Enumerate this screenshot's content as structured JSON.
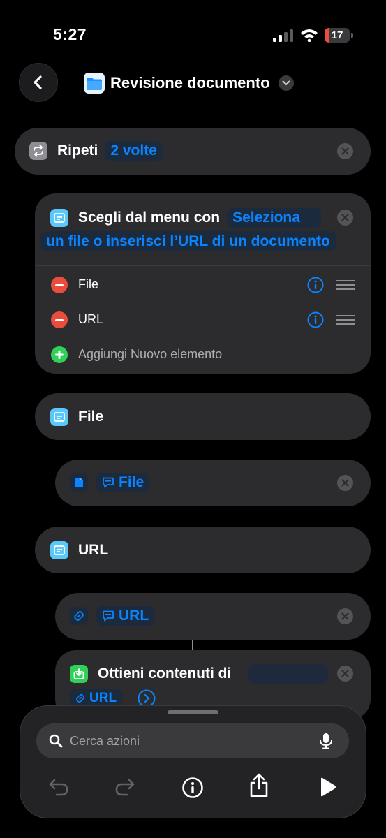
{
  "status_bar": {
    "time": "5:27",
    "battery": "17",
    "battery_level": 0.17
  },
  "nav": {
    "title": "Revisione documento"
  },
  "repeat_block": {
    "label": "Ripeti",
    "count_token": "2 volte"
  },
  "menu_block": {
    "label": "Scegli dal menu con",
    "prompt_token_line1": "Seleziona",
    "prompt_token_line2": "un file o inserisci l’URL di un documento",
    "items": [
      {
        "label": "File"
      },
      {
        "label": "URL"
      }
    ],
    "add_label": "Aggiungi Nuovo elemento"
  },
  "case_file": {
    "label": "File",
    "var_token": "File"
  },
  "case_url": {
    "label": "URL",
    "var_token": "URL"
  },
  "get_contents": {
    "label": "Ottieni contenuti di",
    "var_token": "URL"
  },
  "bottom_panel": {
    "search_placeholder": "Cerca azioni"
  },
  "colors": {
    "accent": "#0a84ff",
    "card": "#2c2c2e",
    "remove": "#eb4d3d",
    "add": "#30d158",
    "action_icon": "#5ac8fa"
  }
}
